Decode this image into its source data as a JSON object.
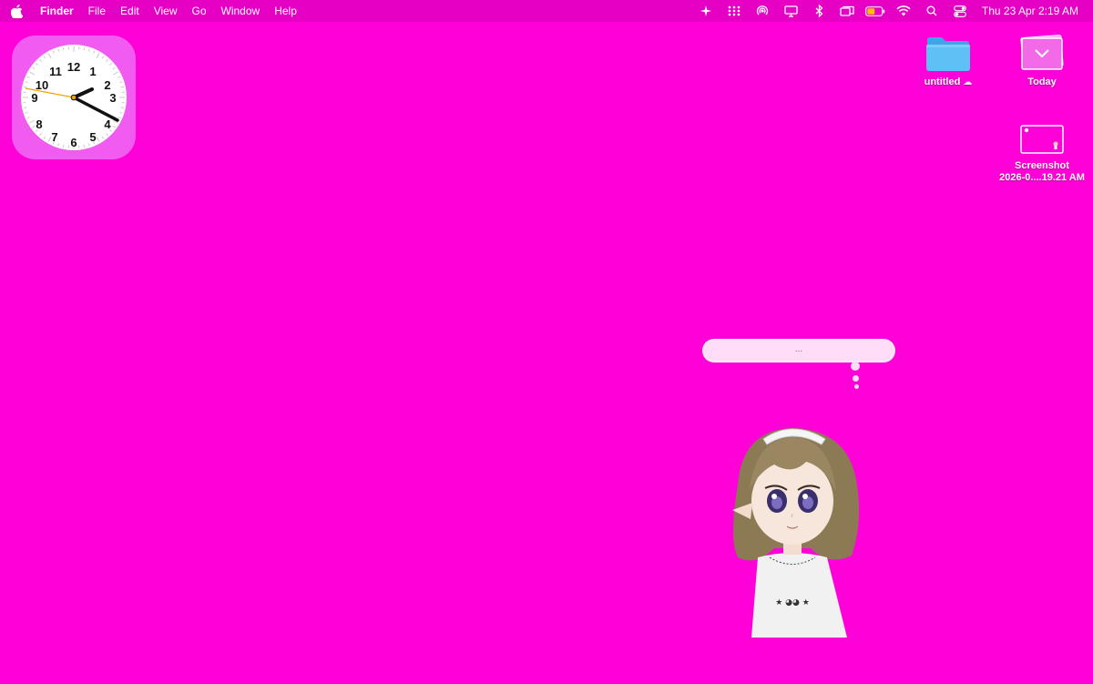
{
  "menubar": {
    "app_name": "Finder",
    "items": [
      "File",
      "Edit",
      "View",
      "Go",
      "Window",
      "Help"
    ],
    "status_icons": [
      "sparkle-icon",
      "launchpad-grid-icon",
      "airdrop-icon",
      "display-icon",
      "bluetooth-icon",
      "screen-mirroring-icon",
      "battery-icon",
      "wifi-icon",
      "spotlight-search-icon",
      "control-center-icon"
    ],
    "datetime": "Thu 23 Apr  2:19 AM"
  },
  "clock_widget": {
    "numbers": [
      "12",
      "1",
      "2",
      "3",
      "4",
      "5",
      "6",
      "7",
      "8",
      "9",
      "10",
      "11"
    ]
  },
  "desktop_icons": [
    {
      "label": "untitled",
      "badge": "☁",
      "icon": "folder-icon"
    },
    {
      "label": "Today",
      "icon": "stack-icon"
    },
    {
      "label_line1": "Screenshot",
      "label_line2": "2026-0....19.21 AM",
      "icon": "screenshot-thumbnail-icon"
    }
  ],
  "thought_bubble": {
    "text": "..."
  },
  "colors": {
    "desktop": "#ff00d8",
    "menubar": "#e600c4",
    "widget": "#f25bf0",
    "folder": "#57b8f2",
    "bubble": "#ffdcf7"
  }
}
